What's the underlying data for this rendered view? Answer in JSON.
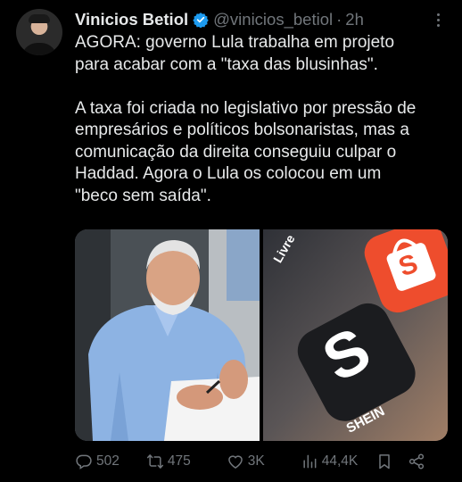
{
  "author": {
    "name": "Vinicios Betiol",
    "handle": "@vinicios_betiol",
    "separator": "·",
    "time": "2h"
  },
  "tweet": {
    "paragraph1": "AGORA: governo Lula trabalha em projeto\npara acabar com a \"taxa das blusinhas\".",
    "paragraph2": "A taxa foi criada no legislativo por pressão de\nempresários e políticos bolsonaristas, mas a\ncomunicação da direita conseguiu culpar o\nHaddad. Agora o Lula os colocou em um\n\"beco sem saída\"."
  },
  "media": {
    "photo2_labels": {
      "livre": "Livre",
      "shein": "SHEIN",
      "shein_logo_letter": "S",
      "shopee_letter": "S"
    }
  },
  "actions": {
    "replies": "502",
    "retweets": "475",
    "likes": "3K",
    "views": "44,4K"
  },
  "colors": {
    "background": "#000000",
    "text": "#e7e9ea",
    "secondary": "#71767b",
    "verified": "#1d9bf0",
    "shopee": "#ee4d2d"
  },
  "icons": [
    "verified-badge-icon",
    "more-icon",
    "reply-icon",
    "retweet-icon",
    "like-icon",
    "views-icon",
    "bookmark-icon",
    "share-icon"
  ]
}
